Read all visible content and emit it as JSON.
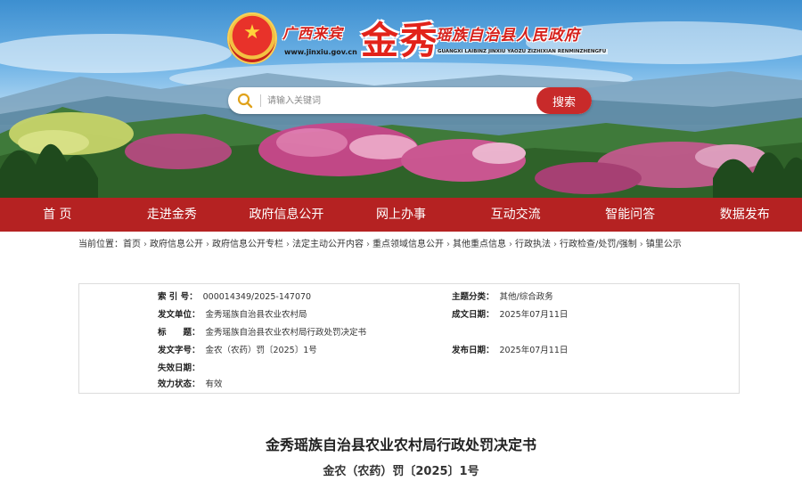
{
  "header": {
    "region_name": "广西来宾",
    "site_url": "www.jinxiu.gov.cn",
    "brand_name": "金秀",
    "government_name": "瑶族自治县人民政府",
    "pinyin_line": "GUANGXI LAIBINZ JINXIU YAOZU ZIZHIXIAN RENMINZHENGFU"
  },
  "search": {
    "placeholder": "请输入关键词",
    "button_label": "搜索"
  },
  "nav": {
    "items": [
      "首 页",
      "走进金秀",
      "政府信息公开",
      "网上办事",
      "互动交流",
      "智能问答",
      "数据发布"
    ]
  },
  "breadcrumb": {
    "prefix": "当前位置：",
    "items": [
      "首页",
      "政府信息公开",
      "政府信息公开专栏",
      "法定主动公开内容",
      "重点领域信息公开",
      "其他重点信息",
      "行政执法",
      "行政检查/处罚/强制",
      "镇里公示"
    ]
  },
  "info": {
    "index_label": "索 引 号：",
    "index_value": "000014349/2025-147070",
    "issuer_label": "发文单位：",
    "issuer_value": "金秀瑶族自治县农业农村局",
    "title_label": "标　　题：",
    "title_value": "金秀瑶族自治县农业农村局行政处罚决定书",
    "doc_no_label": "发文字号：",
    "doc_no_value": "金农（农药）罚〔2025〕1号",
    "expiry_label": "失效日期：",
    "expiry_value": "",
    "validity_label": "效力状态：",
    "validity_value": "有效",
    "category_label": "主题分类：",
    "category_value": "其他/综合政务",
    "created_label": "成文日期：",
    "created_value": "2025年07月11日",
    "published_label": "发布日期：",
    "published_value": "2025年07月11日"
  },
  "document": {
    "title": "金秀瑶族自治县农业农村局行政处罚决定书",
    "number": "金农（农药）罚〔2025〕1号"
  }
}
